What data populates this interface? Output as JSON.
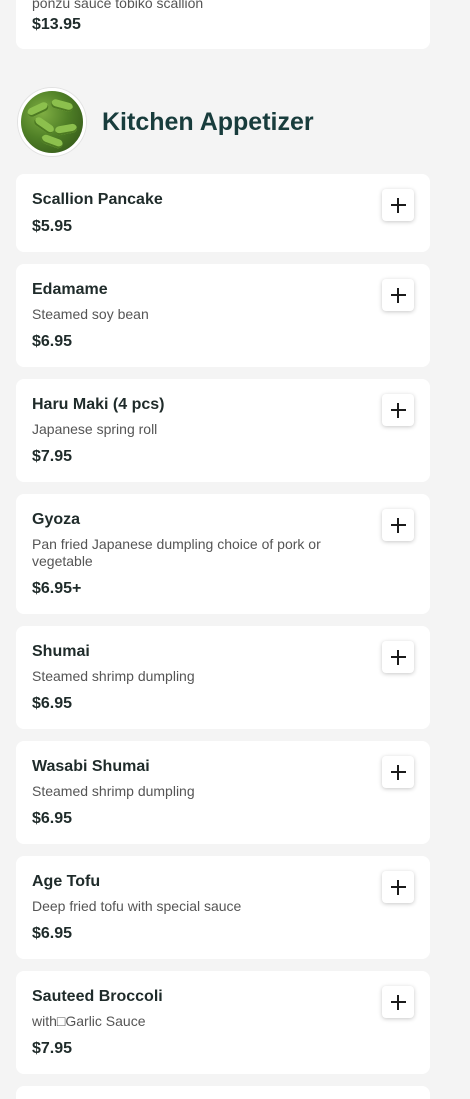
{
  "top_card": {
    "partial_desc": "ponzu sauce tobiko scallion",
    "price": "$13.95"
  },
  "section": {
    "title": "Kitchen Appetizer",
    "image_icon": "edamame-photo"
  },
  "items": [
    {
      "name": "Scallion Pancake",
      "desc": "",
      "price": "$5.95"
    },
    {
      "name": "Edamame",
      "desc": "Steamed soy bean",
      "price": "$6.95"
    },
    {
      "name": "Haru Maki (4 pcs)",
      "desc": "Japanese spring roll",
      "price": "$7.95"
    },
    {
      "name": "Gyoza",
      "desc": "Pan fried Japanese dumpling choice of pork or vegetable",
      "price": "$6.95+"
    },
    {
      "name": "Shumai",
      "desc": "Steamed shrimp dumpling",
      "price": "$6.95"
    },
    {
      "name": "Wasabi Shumai",
      "desc": "Steamed shrimp dumpling",
      "price": "$6.95"
    },
    {
      "name": "Age Tofu",
      "desc": "Deep fried tofu with special sauce",
      "price": "$6.95"
    },
    {
      "name": "Sauteed Broccoli",
      "desc": "with□Garlic Sauce",
      "price": "$7.95"
    }
  ],
  "add_icon": "plus-icon",
  "colors": {
    "background": "#f4f4f4",
    "card": "#ffffff",
    "title": "#183c3c"
  }
}
